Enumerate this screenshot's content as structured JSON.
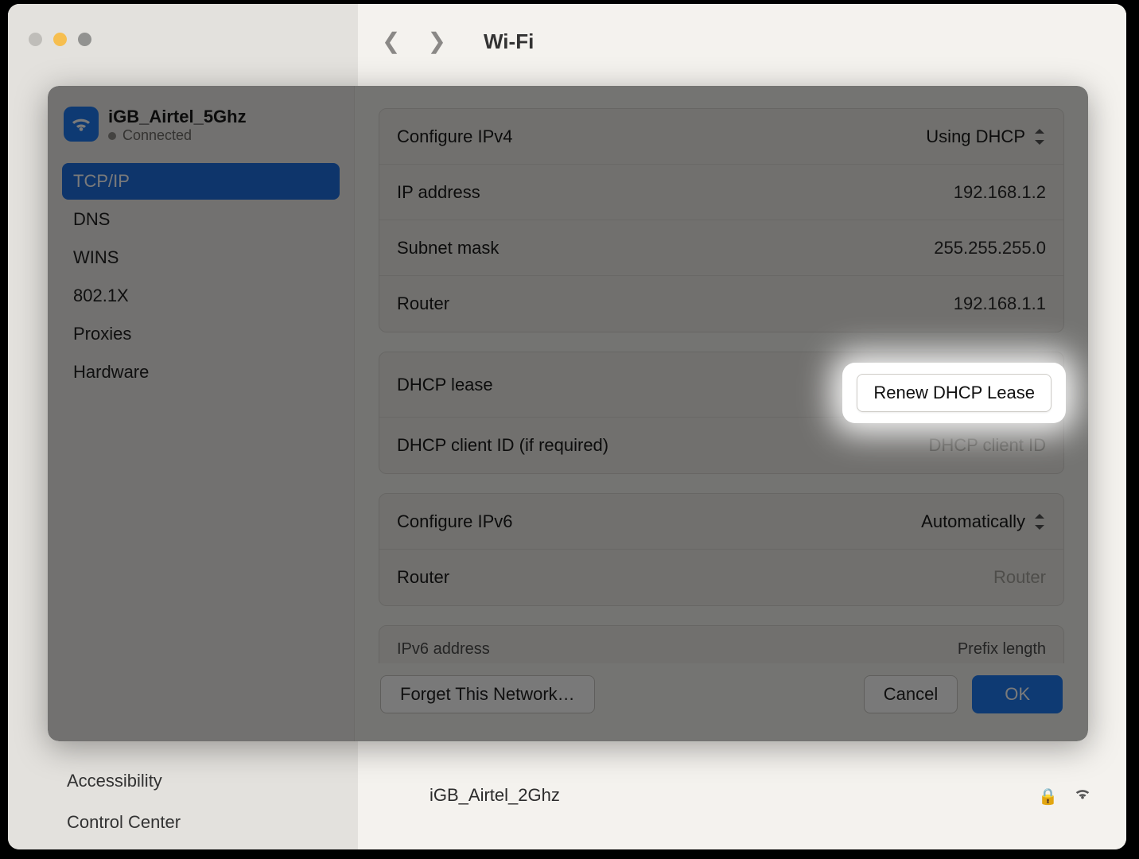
{
  "window": {
    "title": "Wi-Fi"
  },
  "background": {
    "accessibility_label": "Accessibility",
    "control_center_label": "Control Center",
    "other_network": "iGB_Airtel_2Ghz"
  },
  "sheet": {
    "network_name": "iGB_Airtel_5Ghz",
    "status_label": "Connected",
    "tabs": [
      "TCP/IP",
      "DNS",
      "WINS",
      "802.1X",
      "Proxies",
      "Hardware"
    ],
    "active_tab_index": 0,
    "ipv4": {
      "configure_label": "Configure IPv4",
      "configure_value": "Using DHCP",
      "ip_label": "IP address",
      "ip_value": "192.168.1.2",
      "mask_label": "Subnet mask",
      "mask_value": "255.255.255.0",
      "router_label": "Router",
      "router_value": "192.168.1.1"
    },
    "dhcp": {
      "lease_label": "DHCP lease",
      "renew_button": "Renew DHCP Lease",
      "client_id_label": "DHCP client ID (if required)",
      "client_id_placeholder": "DHCP client ID"
    },
    "ipv6": {
      "configure_label": "Configure IPv6",
      "configure_value": "Automatically",
      "router_label": "Router",
      "router_placeholder": "Router",
      "addr_header": "IPv6 address",
      "prefix_header": "Prefix length"
    },
    "footer": {
      "forget": "Forget This Network…",
      "cancel": "Cancel",
      "ok": "OK"
    }
  }
}
